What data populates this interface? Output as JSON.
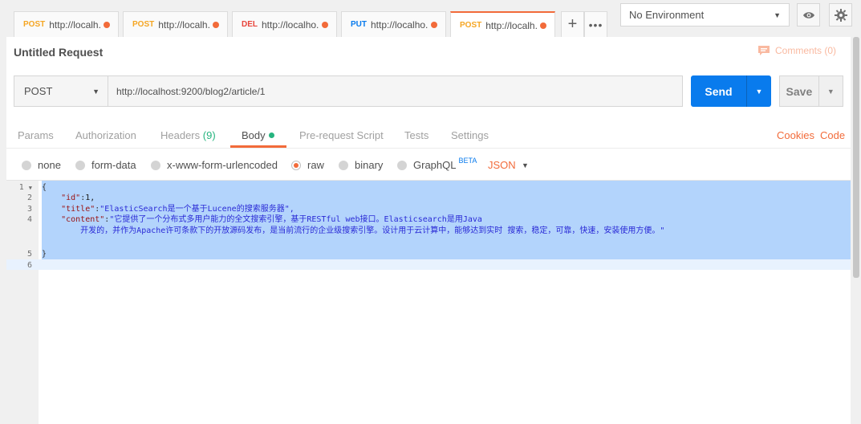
{
  "tabs": [
    {
      "method": "POST",
      "method_color": "#f5a623",
      "url": "http://localh..."
    },
    {
      "method": "POST",
      "method_color": "#f5a623",
      "url": "http://localh..."
    },
    {
      "method": "DEL",
      "method_color": "#e8453c",
      "url": "http://localho..."
    },
    {
      "method": "PUT",
      "method_color": "#097bed",
      "url": "http://localho..."
    },
    {
      "method": "POST",
      "method_color": "#f5a623",
      "url": "http://localh..."
    }
  ],
  "env": {
    "label": "No Environment"
  },
  "request": {
    "name": "Untitled Request",
    "comments": "Comments (0)",
    "method": "POST",
    "url": "http://localhost:9200/blog2/article/1",
    "send": "Send",
    "save": "Save"
  },
  "subtabs": {
    "params": "Params",
    "authorization": "Authorization",
    "headers": "Headers",
    "headers_count": "(9)",
    "body": "Body",
    "prerequest": "Pre-request Script",
    "tests": "Tests",
    "settings": "Settings",
    "cookies": "Cookies",
    "code": "Code"
  },
  "body_options": {
    "none": "none",
    "form_data": "form-data",
    "urlencoded": "x-www-form-urlencoded",
    "raw": "raw",
    "binary": "binary",
    "graphql": "GraphQL",
    "beta": "BETA",
    "format": "JSON"
  },
  "editor": {
    "line_numbers": [
      "1",
      "2",
      "3",
      "4",
      "",
      "5",
      "6"
    ],
    "open_brace": "{",
    "close_brace": "}",
    "id_key": "\"id\"",
    "id_val": "1,",
    "title_key": "\"title\"",
    "title_val": "\"ElasticSearch是一个基于Lucene的搜索服务器\",",
    "content_key": "\"content\"",
    "content_val1": "\"它提供了一个分布式多用户能力的全文搜索引擎，基于RESTful web接口。Elasticsearch是用Java",
    "content_val2": "开发的，并作为Apache许可条款下的开放源码发布，是当前流行的企业级搜索引擎。设计用于云计算中，能够达到实时 搜索，稳定，可靠，快速，安装使用方便。\""
  }
}
